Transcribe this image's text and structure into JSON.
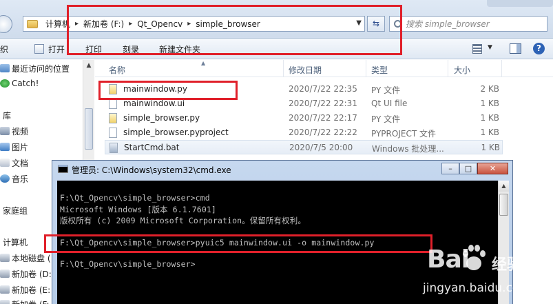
{
  "explorer": {
    "breadcrumbs": [
      "计算机",
      "新加卷 (F:)",
      "Qt_Opencv",
      "simple_browser"
    ],
    "search_placeholder": "搜索 simple_browser",
    "toolbar": {
      "partial_left": "织",
      "open": "打开",
      "print": "打印",
      "burn": "刻录",
      "new_folder": "新建文件夹"
    },
    "nav": {
      "recent": "最近访问的位置",
      "catch": "Catch!",
      "libraries": "库",
      "videos": "视频",
      "pictures": "图片",
      "documents": "文档",
      "music": "音乐",
      "homegroup": "家庭组",
      "computer": "计算机",
      "drive_c": "本地磁盘 (",
      "drive_d": "新加卷 (D:",
      "drive_e": "新加卷 (E:",
      "drive_f": "新加卷 (F:"
    },
    "columns": {
      "name": "名称",
      "modified": "修改日期",
      "type": "类型",
      "size": "大小"
    },
    "files": [
      {
        "name": "mainwindow.py",
        "date": "2020/7/22 22:35",
        "type": "PY 文件",
        "size": "2 KB"
      },
      {
        "name": "mainwindow.ui",
        "date": "2020/7/22 22:31",
        "type": "Qt UI file",
        "size": "1 KB"
      },
      {
        "name": "simple_browser.py",
        "date": "2020/7/22 22:17",
        "type": "PY 文件",
        "size": "1 KB"
      },
      {
        "name": "simple_browser.pyproject",
        "date": "2020/7/22 22:22",
        "type": "PYPROJECT 文件",
        "size": "1 KB"
      },
      {
        "name": "StartCmd.bat",
        "date": "2020/7/5 20:00",
        "type": "Windows 批处理...",
        "size": "1 KB"
      }
    ]
  },
  "cmd": {
    "title": "管理员: C:\\Windows\\system32\\cmd.exe",
    "controls": {
      "minimize": "–",
      "maximize": "□",
      "close": "✕"
    },
    "lines": [
      "F:\\Qt_Opencv\\simple_browser>cmd",
      "Microsoft Windows [版本 6.1.7601]",
      "版权所有 (c) 2009 Microsoft Corporation。保留所有权利。",
      "",
      "F:\\Qt_Opencv\\simple_browser>pyuic5 mainwindow.ui -o mainwindow.py",
      "",
      "F:\\Qt_Opencv\\simple_browser>"
    ]
  },
  "watermark": {
    "logo": "Bai",
    "brand": "经验",
    "url": "jingyan.baidu.com"
  },
  "colors": {
    "annotation_red": "#e0202a",
    "console_bg": "#000000",
    "console_text": "#c0c0c0"
  }
}
